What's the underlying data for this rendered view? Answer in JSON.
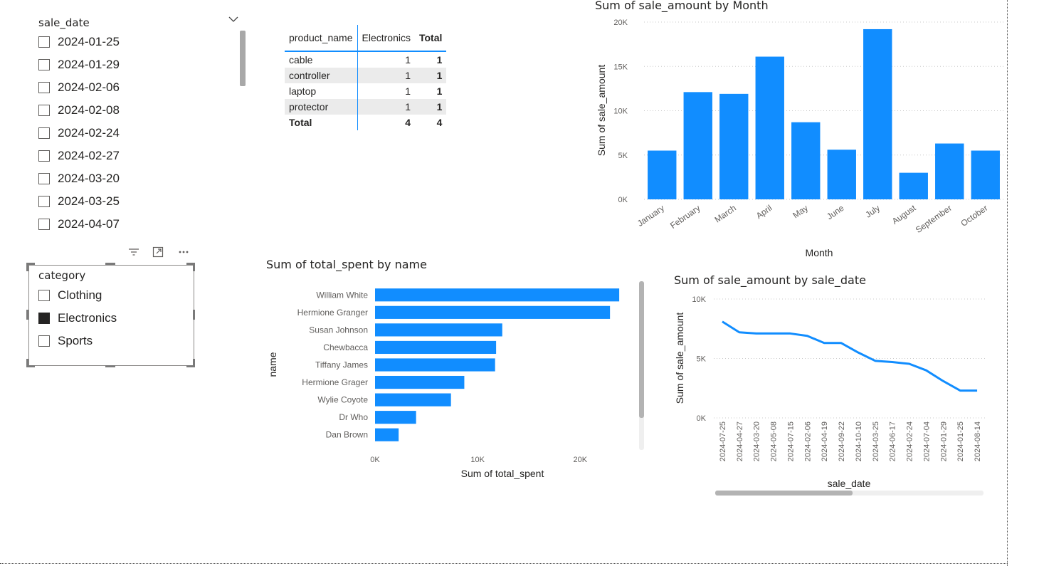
{
  "sale_date_slicer": {
    "title": "sale_date",
    "items": [
      "2024-01-25",
      "2024-01-29",
      "2024-02-06",
      "2024-02-08",
      "2024-02-24",
      "2024-02-27",
      "2024-03-20",
      "2024-03-25",
      "2024-04-07"
    ]
  },
  "category_slicer": {
    "title": "category",
    "items": [
      {
        "label": "Clothing",
        "checked": false
      },
      {
        "label": "Electronics",
        "checked": true
      },
      {
        "label": "Sports",
        "checked": false
      }
    ],
    "header_icons": [
      "filter-icon",
      "focus-mode-icon",
      "more-options-icon"
    ]
  },
  "matrix": {
    "headers": [
      "product_name",
      "Electronics",
      "Total"
    ],
    "rows": [
      {
        "name": "cable",
        "electronics": "1",
        "total": "1"
      },
      {
        "name": "controller",
        "electronics": "1",
        "total": "1"
      },
      {
        "name": "laptop",
        "electronics": "1",
        "total": "1"
      },
      {
        "name": "protector",
        "electronics": "1",
        "total": "1"
      }
    ],
    "total_row": {
      "name": "Total",
      "electronics": "4",
      "total": "4"
    }
  },
  "chart_data": [
    {
      "id": "by_month",
      "type": "bar",
      "title": "Sum of sale_amount by Month",
      "xlabel": "Month",
      "ylabel": "Sum of sale_amount",
      "categories": [
        "January",
        "February",
        "March",
        "April",
        "May",
        "June",
        "July",
        "August",
        "September",
        "October"
      ],
      "values": [
        5500,
        12100,
        11900,
        16100,
        8700,
        5600,
        19200,
        3000,
        6300,
        5500
      ],
      "ylim": [
        0,
        20000
      ],
      "yticks": [
        "0K",
        "5K",
        "10K",
        "15K",
        "20K"
      ],
      "color": "#118dff",
      "grid": true
    },
    {
      "id": "by_name",
      "type": "bar",
      "orientation": "horizontal",
      "title": "Sum of total_spent by name",
      "xlabel": "Sum of total_spent",
      "ylabel": "name",
      "categories": [
        "William White",
        "Hermione Granger",
        "Susan Johnson",
        "Chewbacca",
        "Tiffany James",
        "Hermione Grager",
        "Wylie Coyote",
        "Dr Who",
        "Dan Brown"
      ],
      "values": [
        23800,
        22900,
        12400,
        11800,
        11700,
        8700,
        7400,
        4000,
        2300
      ],
      "xlim": [
        0,
        24000
      ],
      "xticks": [
        "0K",
        "10K",
        "20K"
      ],
      "color": "#118dff"
    },
    {
      "id": "by_sale_date",
      "type": "line",
      "title": "Sum of sale_amount by sale_date",
      "xlabel": "sale_date",
      "ylabel": "Sum of sale_amount",
      "categories": [
        "2024-07-25",
        "2024-04-27",
        "2024-03-20",
        "2024-05-08",
        "2024-07-15",
        "2024-02-06",
        "2024-04-19",
        "2024-09-22",
        "2024-10-10",
        "2024-03-25",
        "2024-06-17",
        "2024-02-24",
        "2024-07-04",
        "2024-01-29",
        "2024-01-25",
        "2024-08-14"
      ],
      "values": [
        8100,
        7200,
        7100,
        7100,
        7100,
        6900,
        6300,
        6300,
        5500,
        4800,
        4700,
        4550,
        4000,
        3100,
        2300,
        2300
      ],
      "ylim": [
        0,
        10000
      ],
      "yticks": [
        "0K",
        "5K",
        "10K"
      ],
      "color": "#118dff",
      "grid": true
    }
  ]
}
